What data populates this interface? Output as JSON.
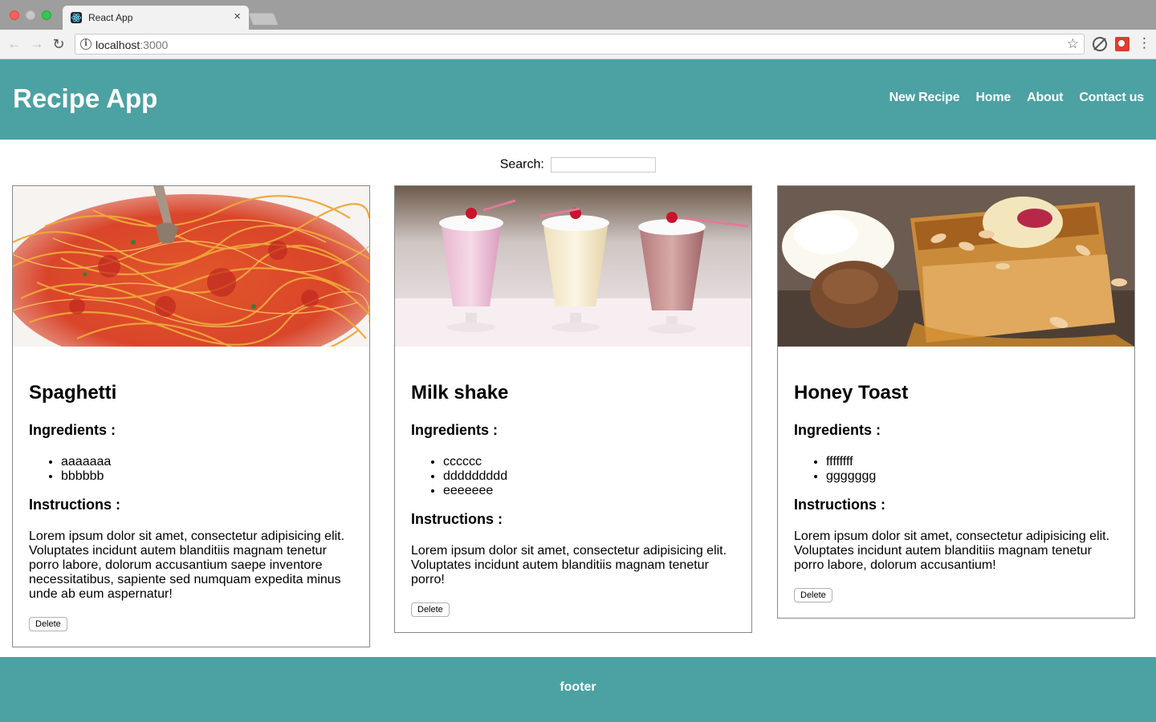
{
  "browser": {
    "tab_title": "React App",
    "url_host": "localhost",
    "url_port": ":3000"
  },
  "header": {
    "title": "Recipe App",
    "nav": [
      "New Recipe",
      "Home",
      "About",
      "Contact us"
    ]
  },
  "search": {
    "label": "Search:",
    "value": ""
  },
  "labels": {
    "ingredients": "Ingredients :",
    "instructions": "Instructions :",
    "delete": "Delete"
  },
  "recipes": [
    {
      "name": "Spaghetti",
      "image": "spaghetti-photo",
      "ingredients": [
        "aaaaaaa",
        "bbbbbb"
      ],
      "instructions": "Lorem ipsum dolor sit amet, consectetur adipisicing elit. Voluptates incidunt autem blanditiis magnam tenetur porro labore, dolorum accusantium saepe inventore necessitatibus, sapiente sed numquam expedita minus unde ab eum aspernatur!"
    },
    {
      "name": "Milk shake",
      "image": "milkshake-photo",
      "ingredients": [
        "cccccc",
        "ddddddddd",
        "eeeeeee"
      ],
      "instructions": "Lorem ipsum dolor sit amet, consectetur adipisicing elit. Voluptates incidunt autem blanditiis magnam tenetur porro!"
    },
    {
      "name": "Honey Toast",
      "image": "honey-toast-photo",
      "ingredients": [
        "ffffffff",
        "ggggggg"
      ],
      "instructions": "Lorem ipsum dolor sit amet, consectetur adipisicing elit. Voluptates incidunt autem blanditiis magnam tenetur porro labore, dolorum accusantium!"
    }
  ],
  "footer": {
    "text": "footer"
  },
  "colors": {
    "brand": "#4ca1a3",
    "header_text": "#ffffff"
  }
}
